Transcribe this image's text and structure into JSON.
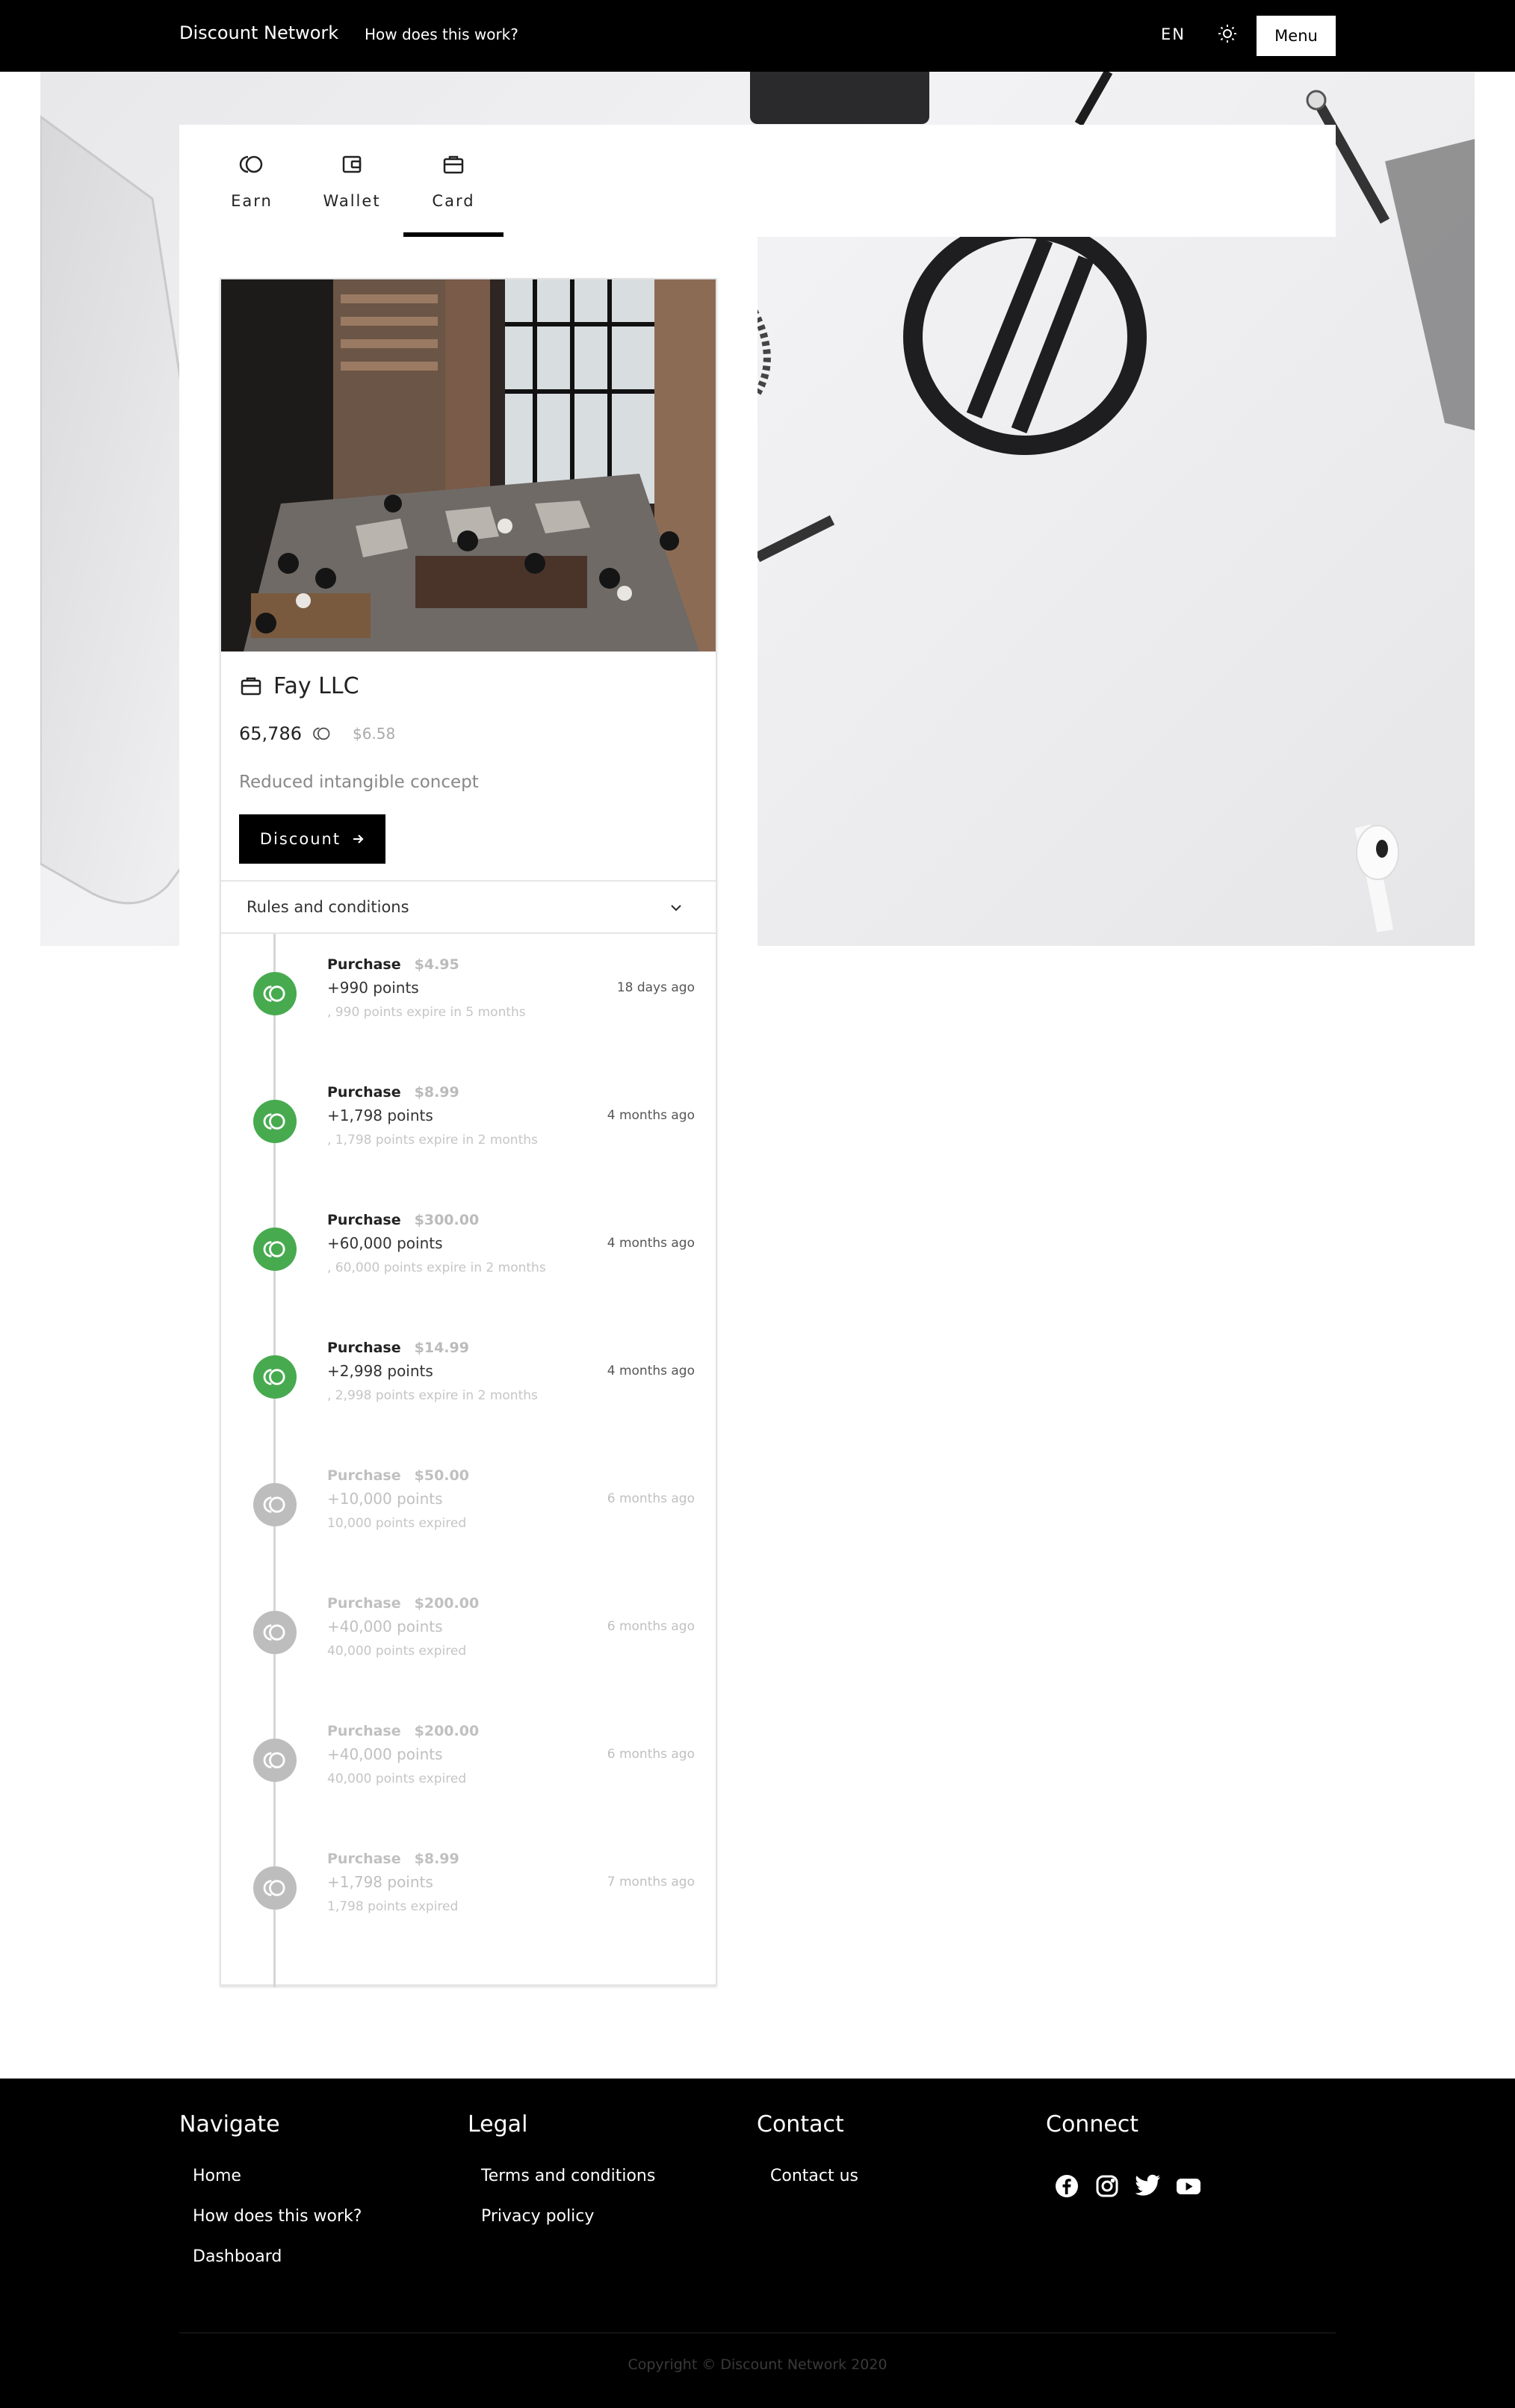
{
  "nav": {
    "brand": "Discount Network",
    "how_link": "How does this work?",
    "language": "EN",
    "theme_icon": "sun-icon",
    "menu_label": "Menu"
  },
  "tabs": [
    {
      "label": "Earn",
      "icon": "coin-icon",
      "active": false
    },
    {
      "label": "Wallet",
      "icon": "wallet-icon",
      "active": false
    },
    {
      "label": "Card",
      "icon": "card-icon",
      "active": true
    }
  ],
  "card": {
    "title": "Fay LLC",
    "points": "65,786",
    "dollars": "$6.58",
    "description": "Reduced intangible concept",
    "discount_label": "Discount",
    "rules_label": "Rules and conditions"
  },
  "transactions": [
    {
      "title": "Purchase",
      "amount": "$4.95",
      "points": "+990 points",
      "note": ", 990 points expire in 5 months",
      "time": "18 days ago",
      "status": "active"
    },
    {
      "title": "Purchase",
      "amount": "$8.99",
      "points": "+1,798 points",
      "note": ", 1,798 points expire in 2 months",
      "time": "4 months ago",
      "status": "active"
    },
    {
      "title": "Purchase",
      "amount": "$300.00",
      "points": "+60,000 points",
      "note": ", 60,000 points expire in 2 months",
      "time": "4 months ago",
      "status": "active"
    },
    {
      "title": "Purchase",
      "amount": "$14.99",
      "points": "+2,998 points",
      "note": ", 2,998 points expire in 2 months",
      "time": "4 months ago",
      "status": "active"
    },
    {
      "title": "Purchase",
      "amount": "$50.00",
      "points": "+10,000 points",
      "note": "10,000 points expired",
      "time": "6 months ago",
      "status": "expired"
    },
    {
      "title": "Purchase",
      "amount": "$200.00",
      "points": "+40,000 points",
      "note": "40,000 points expired",
      "time": "6 months ago",
      "status": "expired"
    },
    {
      "title": "Purchase",
      "amount": "$200.00",
      "points": "+40,000 points",
      "note": "40,000 points expired",
      "time": "6 months ago",
      "status": "expired"
    },
    {
      "title": "Purchase",
      "amount": "$8.99",
      "points": "+1,798 points",
      "note": "1,798 points expired",
      "time": "7 months ago",
      "status": "expired"
    }
  ],
  "colors": {
    "active_dot": "#47aa4f",
    "expired_dot": "#bdbdbd",
    "nav_bg": "#000000"
  },
  "footer": {
    "navigate": {
      "heading": "Navigate",
      "links": [
        "Home",
        "How does this work?",
        "Dashboard"
      ]
    },
    "legal": {
      "heading": "Legal",
      "links": [
        "Terms and conditions",
        "Privacy policy"
      ]
    },
    "contact": {
      "heading": "Contact",
      "links": [
        "Contact us"
      ]
    },
    "connect": {
      "heading": "Connect",
      "icons": [
        "facebook-icon",
        "instagram-icon",
        "twitter-icon",
        "youtube-icon"
      ]
    },
    "copyright": "Copyright © Discount Network 2020"
  }
}
